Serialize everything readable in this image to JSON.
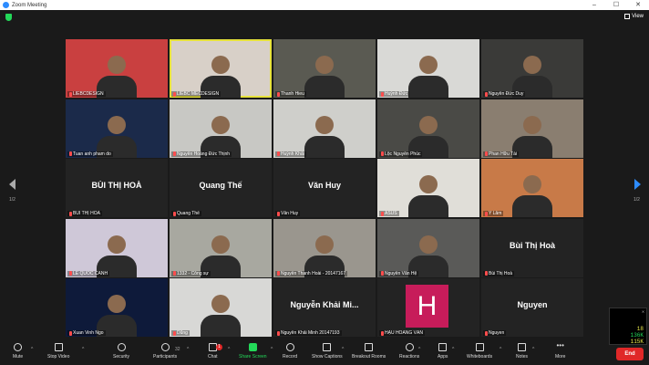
{
  "window": {
    "title": "Zoom Meeting",
    "controls": [
      "–",
      "☐",
      "✕"
    ]
  },
  "top": {
    "view_label": "View"
  },
  "pager": {
    "left": "1/2",
    "right": "1/2"
  },
  "participants": [
    {
      "name": "LIEBCDESIGN",
      "kind": "video",
      "bg": "#c94040"
    },
    {
      "name": "LIEBC MECDESIGN",
      "kind": "video",
      "bg": "#d8d0c8",
      "active": true
    },
    {
      "name": "Thanh Hieu",
      "kind": "video",
      "bg": "#5a5a52"
    },
    {
      "name": "Huỳnh Đức",
      "kind": "video",
      "bg": "#d9d9d6"
    },
    {
      "name": "Nguyễn Đức Duy",
      "kind": "video",
      "bg": "#3a3a38"
    },
    {
      "name": "Tuan anh pham do",
      "kind": "video",
      "bg": "#1b2a4a"
    },
    {
      "name": "Nguyễn Hoàng Đức Thịnh",
      "kind": "video",
      "bg": "#c8c8c4"
    },
    {
      "name": "Huỳnh Khải",
      "kind": "video",
      "bg": "#cfcfcb"
    },
    {
      "name": "Lộc Nguyễn Phúc",
      "kind": "video",
      "bg": "#4a4a46"
    },
    {
      "name": "Phan Hữu Tài",
      "kind": "video",
      "bg": "#8a7e70"
    },
    {
      "name": "BÙI THỊ HOÀ",
      "kind": "name",
      "display": "BÙI THỊ HOÀ"
    },
    {
      "name": "Quang Thế",
      "kind": "name",
      "display": "Quang Thế"
    },
    {
      "name": "Văn Huy",
      "kind": "name",
      "display": "Văn Huy"
    },
    {
      "name": "ASUS",
      "kind": "video",
      "bg": "#e0ded8"
    },
    {
      "name": "Y Lâm",
      "kind": "video",
      "bg": "#c87a48"
    },
    {
      "name": "LÊ QUỐC CẢNH",
      "kind": "video",
      "bg": "#cfc8d8"
    },
    {
      "name": "1332 - Công sự",
      "kind": "video",
      "bg": "#a8a8a0"
    },
    {
      "name": "Nguyễn Thanh Hoài - 20147167",
      "kind": "video",
      "bg": "#9a968e"
    },
    {
      "name": "Nguyễn Văn Hệ",
      "kind": "video",
      "bg": "#5a5a58"
    },
    {
      "name": "Bùi Thị Hoà",
      "kind": "name",
      "display": "Bùi Thị Hoà"
    },
    {
      "name": "Xuan Vinh Ngo",
      "kind": "video",
      "bg": "#0e1a3a"
    },
    {
      "name": "Dũng",
      "kind": "video",
      "bg": "#d8d8d6"
    },
    {
      "name": "Nguyễn Khải Minh 20147193",
      "kind": "name",
      "display": "Nguyễn Khải Mi..."
    },
    {
      "name": "HẬU HOÀNG VĂN",
      "kind": "avatar",
      "letter": "H"
    },
    {
      "name": "Nguyen",
      "kind": "name",
      "display": "Nguyen"
    }
  ],
  "toolbar": {
    "mute": "Mute",
    "stop_video": "Stop Video",
    "security": "Security",
    "participants": "Participants",
    "participants_count": "32",
    "chat": "Chat",
    "chat_badge": "1",
    "share_screen": "Share Screen",
    "record": "Record",
    "show_captions": "Show Captions",
    "breakout_rooms": "Breakout Rooms",
    "reactions": "Reactions",
    "apps": "Apps",
    "whiteboards": "Whiteboards",
    "notes": "Notes",
    "more": "More",
    "end": "End"
  },
  "stats": {
    "v1": "18",
    "v2": "136K",
    "v3": "115K"
  },
  "colors": {
    "accent": "#2d8cff",
    "end": "#e02828",
    "share": "#23d959",
    "active_border": "#e7e23b"
  }
}
